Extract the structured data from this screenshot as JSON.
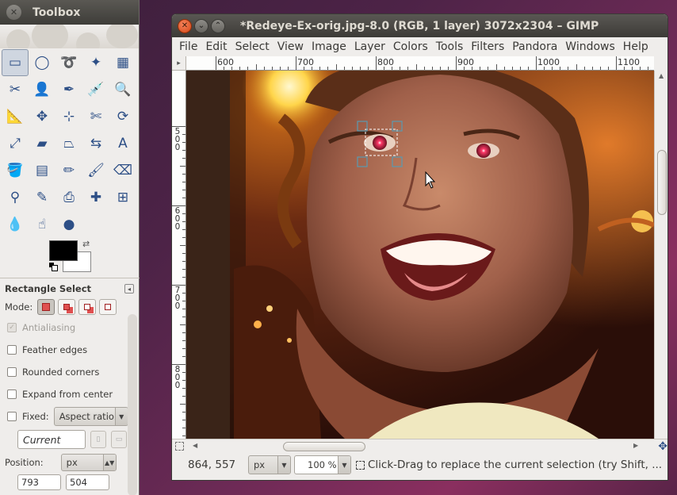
{
  "toolbox": {
    "title": "Toolbox",
    "tools": [
      {
        "name": "rect-select-tool",
        "glyph": "▭",
        "active": true
      },
      {
        "name": "ellipse-select-tool",
        "glyph": "◯"
      },
      {
        "name": "free-select-tool",
        "glyph": "➰"
      },
      {
        "name": "fuzzy-select-tool",
        "glyph": "✦"
      },
      {
        "name": "select-by-color-tool",
        "glyph": "▦"
      },
      {
        "name": "scissors-select-tool",
        "glyph": "✂"
      },
      {
        "name": "foreground-select-tool",
        "glyph": "👤"
      },
      {
        "name": "paths-tool",
        "glyph": "✒"
      },
      {
        "name": "color-picker-tool",
        "glyph": "💉"
      },
      {
        "name": "zoom-tool",
        "glyph": "🔍"
      },
      {
        "name": "measure-tool",
        "glyph": "📐"
      },
      {
        "name": "move-tool",
        "glyph": "✥"
      },
      {
        "name": "align-tool",
        "glyph": "⊹"
      },
      {
        "name": "crop-tool",
        "glyph": "✄"
      },
      {
        "name": "rotate-tool",
        "glyph": "⟳"
      },
      {
        "name": "scale-tool",
        "glyph": "⤢"
      },
      {
        "name": "shear-tool",
        "glyph": "▰"
      },
      {
        "name": "perspective-tool",
        "glyph": "⏢"
      },
      {
        "name": "flip-tool",
        "glyph": "⇆"
      },
      {
        "name": "text-tool",
        "glyph": "A"
      },
      {
        "name": "bucket-fill-tool",
        "glyph": "🪣"
      },
      {
        "name": "blend-tool",
        "glyph": "▤"
      },
      {
        "name": "pencil-tool",
        "glyph": "✏"
      },
      {
        "name": "paintbrush-tool",
        "glyph": "🖌"
      },
      {
        "name": "eraser-tool",
        "glyph": "⌫"
      },
      {
        "name": "airbrush-tool",
        "glyph": "⚲"
      },
      {
        "name": "ink-tool",
        "glyph": "✎"
      },
      {
        "name": "clone-tool",
        "glyph": "⎙"
      },
      {
        "name": "heal-tool",
        "glyph": "✚"
      },
      {
        "name": "perspective-clone-tool",
        "glyph": "⊞"
      },
      {
        "name": "blur-sharpen-tool",
        "glyph": "💧"
      },
      {
        "name": "smudge-tool",
        "glyph": "☝"
      },
      {
        "name": "dodge-burn-tool",
        "glyph": "●"
      }
    ],
    "fg_color": "#000000",
    "bg_color": "#ffffff"
  },
  "tool_options": {
    "title": "Rectangle Select",
    "mode_label": "Mode:",
    "antialiasing": "Antialiasing",
    "feather_edges": "Feather edges",
    "rounded_corners": "Rounded corners",
    "expand_from_center": "Expand from center",
    "fixed_label": "Fixed:",
    "fixed_value": "Aspect ratio",
    "current_value": "Current",
    "position_label": "Position:",
    "position_unit": "px",
    "pos_x": "793",
    "pos_y": "504"
  },
  "image_window": {
    "title": "*Redeye-Ex-orig.jpg-8.0 (RGB, 1 layer) 3072x2304 – GIMP",
    "menu": [
      "File",
      "Edit",
      "Select",
      "View",
      "Image",
      "Layer",
      "Colors",
      "Tools",
      "Filters",
      "Pandora",
      "Windows",
      "Help"
    ],
    "ruler_h": [
      "600",
      "700",
      "800",
      "900",
      "1000",
      "1100"
    ],
    "ruler_v": [
      "500",
      "600",
      "700",
      "800"
    ],
    "status": {
      "coords": "864, 557",
      "unit": "px",
      "zoom": "100 %",
      "message": "Click-Drag to replace the current selection (try Shift, ..."
    }
  }
}
